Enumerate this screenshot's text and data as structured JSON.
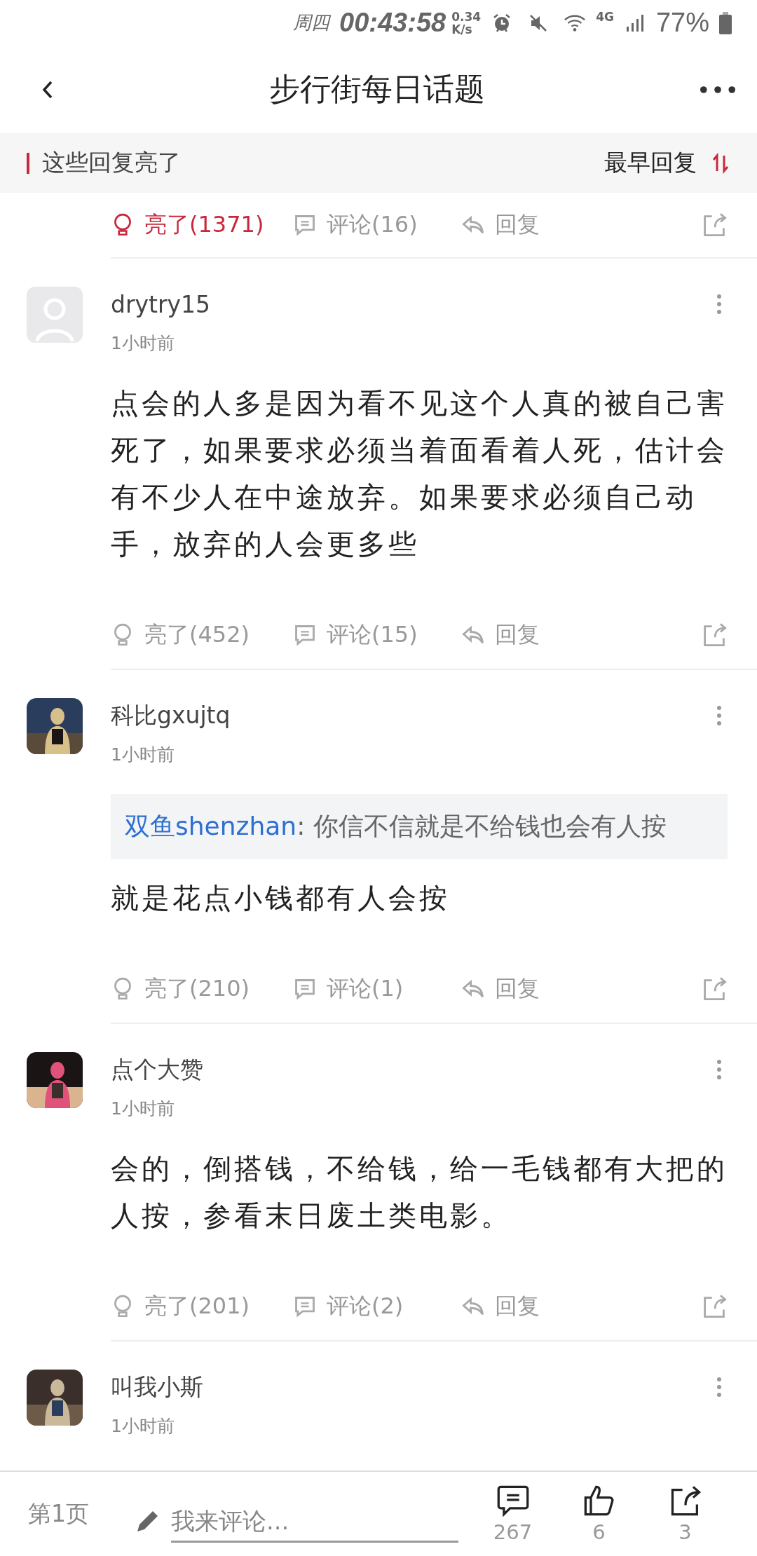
{
  "status_bar": {
    "day": "周四",
    "time": "00:43:58",
    "speed": [
      "0.34",
      "K/s"
    ],
    "network": "4G",
    "battery": "77%"
  },
  "header": {
    "title": "步行街每日话题"
  },
  "section": {
    "title": "这些回复亮了",
    "sort": "最早回复"
  },
  "top_actions": {
    "light": "亮了(1371)",
    "lit": true,
    "comment": "评论(16)",
    "reply": "回复"
  },
  "posts": [
    {
      "avatar": {
        "kind": "default"
      },
      "username": "drytry15",
      "time": "1小时前",
      "content": "点会的人多是因为看不见这个人真的被自己害死了，如果要求必须当着面看着人死，估计会有不少人在中途放弃。如果要求必须自己动手，放弃的人会更多些",
      "actions": {
        "light": "亮了(452)",
        "lit": false,
        "comment": "评论(15)",
        "reply": "回复"
      }
    },
    {
      "username": "科比gxujtq",
      "time": "1小时前",
      "quote": {
        "user": "双鱼shenzhan",
        "text": ": 你信不信就是不给钱也会有人按"
      },
      "content": "就是花点小钱都有人会按",
      "actions": {
        "light": "亮了(210)",
        "lit": false,
        "comment": "评论(1)",
        "reply": "回复"
      }
    },
    {
      "username": "点个大赞",
      "time": "1小时前",
      "content": "会的，倒搭钱，不给钱，给一毛钱都有大把的人按，参看末日废土类电影。",
      "actions": {
        "light": "亮了(201)",
        "lit": false,
        "comment": "评论(2)",
        "reply": "回复"
      }
    },
    {
      "username": "叫我小斯",
      "time": "1小时前"
    }
  ],
  "bottom_bar": {
    "page": "第1页",
    "placeholder": "我来评论...",
    "comments": "267",
    "likes": "6",
    "shares": "3"
  }
}
